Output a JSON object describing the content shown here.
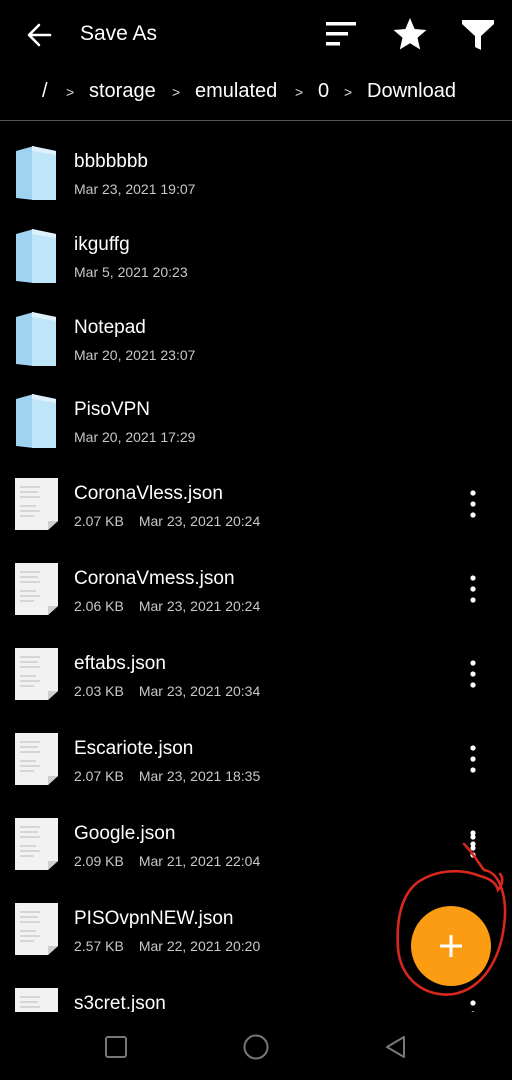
{
  "header": {
    "title": "Save As",
    "icons": [
      "back-arrow-icon",
      "sort-icon",
      "star-icon",
      "filter-icon"
    ]
  },
  "breadcrumb": [
    "/",
    "storage",
    "emulated",
    "0",
    "Download"
  ],
  "folders": [
    {
      "name": "bbbbbbb",
      "date": "Mar 23, 2021 19:07"
    },
    {
      "name": "ikguffg",
      "date": "Mar 5, 2021 20:23"
    },
    {
      "name": "Notepad",
      "date": "Mar 20, 2021 23:07"
    },
    {
      "name": "PisoVPN",
      "date": "Mar 20, 2021 17:29"
    }
  ],
  "files": [
    {
      "name": "CoronaVless.json",
      "size": "2.07 KB",
      "date": "Mar 23, 2021 20:24"
    },
    {
      "name": "CoronaVmess.json",
      "size": "2.06 KB",
      "date": "Mar 23, 2021 20:24"
    },
    {
      "name": "eftabs.json",
      "size": "2.03 KB",
      "date": "Mar 23, 2021 20:34"
    },
    {
      "name": "Escariote.json",
      "size": "2.07 KB",
      "date": "Mar 23, 2021 18:35"
    },
    {
      "name": "Google.json",
      "size": "2.09 KB",
      "date": "Mar 21, 2021 22:04"
    },
    {
      "name": "PISOvpnNEW.json",
      "size": "2.57 KB",
      "date": "Mar 22, 2021 20:20"
    },
    {
      "name": "s3cret.json",
      "size": "",
      "date": ""
    }
  ],
  "fab": {
    "icon": "plus-icon",
    "color": "#fb9c12"
  },
  "annotation_color": "#d8281e",
  "navbar": {
    "icons": [
      "recents-square-icon",
      "home-circle-icon",
      "back-triangle-icon"
    ]
  }
}
